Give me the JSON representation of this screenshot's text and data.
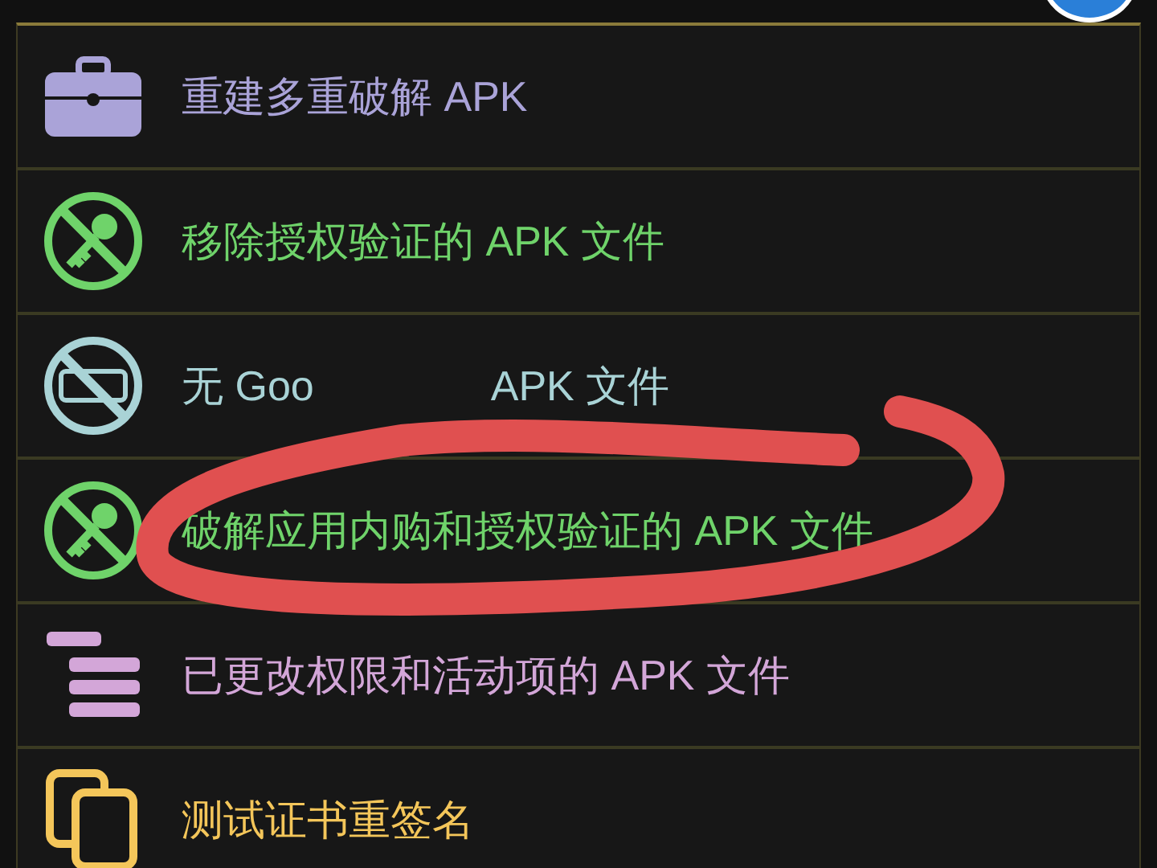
{
  "menu": {
    "items": [
      {
        "kind": "briefcase",
        "color": "#aaa3d8",
        "texts": [
          "重建多重破解 APK"
        ]
      },
      {
        "kind": "no-key",
        "color": "#6fd36a",
        "texts": [
          "移除授权验证的 APK 文件"
        ]
      },
      {
        "kind": "no-ads",
        "color": "#a9d3d6",
        "texts": [
          "无 Goo",
          "APK 文件"
        ]
      },
      {
        "kind": "no-key",
        "color": "#6fd36a",
        "texts": [
          "破解应用内购和授权验证的 APK 文件"
        ]
      },
      {
        "kind": "list",
        "color": "#d3a6d8",
        "texts": [
          "已更改权限和活动项的 APK 文件"
        ]
      },
      {
        "kind": "documents",
        "color": "#f4c65a",
        "texts": [
          "测试证书重签名"
        ]
      }
    ]
  }
}
